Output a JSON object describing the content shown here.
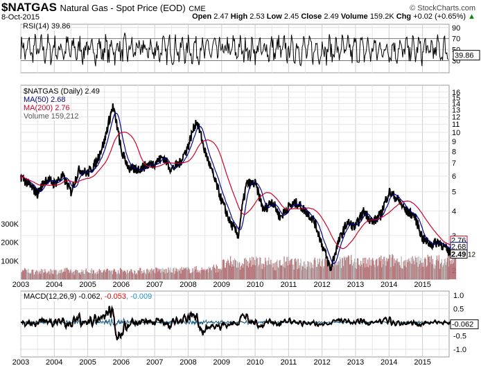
{
  "header": {
    "symbol": "$NATGAS",
    "name": "Natural Gas - Spot Price (EOD)",
    "exchange": "CME",
    "copyright": "© StockCharts.com",
    "date": "8-Oct-2015",
    "open_label": "Open",
    "open": "2.47",
    "high_label": "High",
    "high": "2.53",
    "low_label": "Low",
    "low": "2.45",
    "close_label": "Close",
    "close": "2.49",
    "volume_label": "Volume",
    "volume": "159.2K",
    "chg_label": "Chg",
    "chg": "+0.02 (+0.65%)",
    "up_arrow": "▲"
  },
  "rsi": {
    "legend": "RSI(14) 39.86",
    "last": "39.86",
    "ticks": [
      "90",
      "70",
      "50",
      "30"
    ]
  },
  "main": {
    "legend_price": "$NATGAS (Daily) 2.49",
    "legend_ma50": "MA(50) 2.68",
    "legend_ma200": "MA(200) 2.76",
    "legend_volume": "Volume 159,212",
    "last_price": "2.49",
    "last_ma50": "2.68",
    "last_ma200": "2.76",
    "vol_tag": "12",
    "price_ticks": [
      "16",
      "15",
      "14",
      "13",
      "12",
      "11",
      "10",
      "9",
      "8",
      "7",
      "6",
      "5",
      "4",
      "3",
      "2"
    ],
    "vol_ticks": [
      "300K",
      "200K",
      "100K"
    ]
  },
  "macd": {
    "legend": "MACD(12,26,9) -0.062",
    "signal": ", -0.053",
    "hist": ", -0.009",
    "last": "-0.062",
    "ticks": [
      "1.0",
      "0.5",
      "-0.5",
      "-1.0"
    ]
  },
  "years": [
    "2003",
    "2004",
    "2005",
    "2006",
    "2007",
    "2008",
    "2009",
    "2010",
    "2011",
    "2012",
    "2013",
    "2014",
    "2015"
  ],
  "colors": {
    "price": "#000000",
    "ma50": "#00008b",
    "ma200": "#d0002a",
    "volume": "#b06a6e",
    "macd_hist": "#1f5f80"
  },
  "chart_data": {
    "type": "line",
    "title": "$NATGAS Natural Gas - Spot Price (EOD)",
    "yscale": "log",
    "ylim": [
      1.8,
      17
    ],
    "x": "quarterly 2003Q1-2015Q4",
    "price": [
      6.0,
      5.4,
      4.9,
      5.8,
      5.5,
      6.0,
      5.0,
      6.5,
      6.2,
      7.0,
      9.0,
      13.5,
      8.0,
      6.5,
      6.5,
      6.8,
      7.0,
      7.5,
      6.5,
      7.0,
      8.5,
      11.5,
      8.0,
      6.0,
      4.5,
      3.5,
      3.0,
      5.5,
      5.5,
      4.0,
      4.5,
      3.7,
      4.2,
      4.4,
      4.0,
      3.6,
      2.7,
      2.0,
      2.8,
      3.5,
      3.3,
      4.0,
      3.5,
      3.8,
      5.0,
      4.6,
      4.0,
      3.8,
      2.9,
      2.7,
      2.8,
      2.5
    ],
    "volume_k": [
      45,
      42,
      40,
      44,
      42,
      45,
      40,
      43,
      44,
      42,
      46,
      45,
      44,
      43,
      45,
      46,
      48,
      46,
      47,
      50,
      52,
      50,
      55,
      60,
      80,
      90,
      85,
      95,
      90,
      85,
      80,
      90,
      85,
      80,
      85,
      88,
      90,
      95,
      100,
      95,
      90,
      85,
      90,
      95,
      100,
      95,
      90,
      95,
      100,
      95,
      90,
      110
    ],
    "rsi_ylim": [
      0,
      100
    ],
    "macd_ylim": [
      -1.2,
      1.2
    ]
  }
}
